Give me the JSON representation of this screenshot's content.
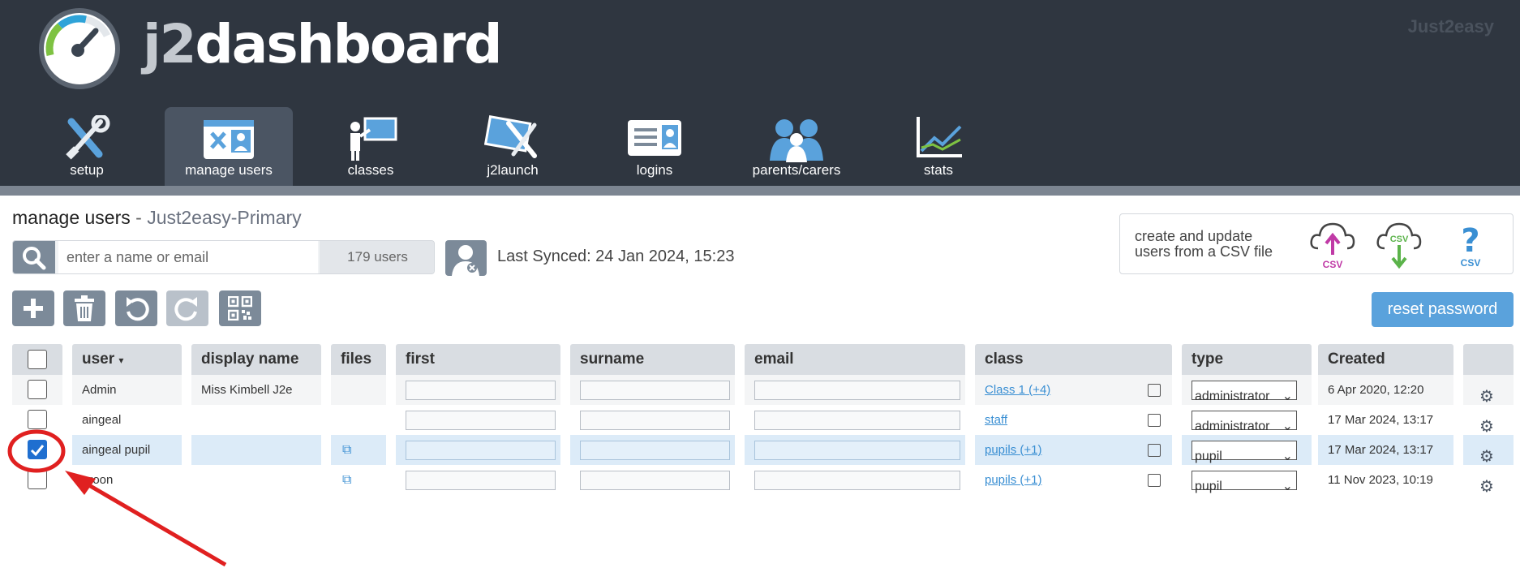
{
  "brand": {
    "logo": "j2dashboard",
    "logo_prefix": "j2",
    "logo_suffix": "dashboard",
    "right": "Just2easy"
  },
  "nav": [
    {
      "label": "setup",
      "icon": "tools-icon"
    },
    {
      "label": "manage users",
      "icon": "manage-users-icon",
      "active": true
    },
    {
      "label": "classes",
      "icon": "classroom-icon"
    },
    {
      "label": "j2launch",
      "icon": "launch-icon"
    },
    {
      "label": "logins",
      "icon": "id-card-icon"
    },
    {
      "label": "parents/carers",
      "icon": "people-icon"
    },
    {
      "label": "stats",
      "icon": "chart-icon"
    }
  ],
  "page": {
    "title": "manage users",
    "separator": "-",
    "school": "Just2easy-Primary"
  },
  "search": {
    "placeholder": "enter a name or email",
    "count": "179 users"
  },
  "sync": {
    "text": "Last Synced: 24 Jan 2024, 15:23"
  },
  "csv": {
    "text_line1": "create and update",
    "text_line2": "users from a CSV file",
    "upload_label": "CSV",
    "download_label": "CSV",
    "help_label": "CSV"
  },
  "toolbar": {
    "reset_label": "reset password"
  },
  "table": {
    "headers": [
      "user",
      "display name",
      "files",
      "first",
      "surname",
      "email",
      "class",
      "type",
      "Created"
    ],
    "sort_indicator": "▾",
    "rows": [
      {
        "user": "Admin",
        "display": "Miss Kimbell J2e",
        "files": false,
        "class": "Class 1 (+4)",
        "type": "administrator",
        "created": "6 Apr 2020, 12:20",
        "checked": false,
        "selected": false
      },
      {
        "user": "aingeal",
        "display": "",
        "files": false,
        "class": "staff",
        "type": "administrator",
        "created": "17 Mar 2024, 13:17",
        "checked": false,
        "selected": false
      },
      {
        "user": "aingeal pupil",
        "display": "",
        "files": true,
        "class": "pupils (+1)",
        "type": "pupil",
        "created": "17 Mar 2024, 13:17",
        "checked": true,
        "selected": true
      },
      {
        "user": "aroon",
        "display": "",
        "files": true,
        "class": "pupils (+1)",
        "type": "pupil",
        "created": "11 Nov 2023, 10:19",
        "checked": false,
        "selected": false
      }
    ],
    "type_options": [
      "administrator",
      "pupil"
    ]
  },
  "colors": {
    "header_bg": "#2f3640",
    "accent_blue": "#5aa2dc",
    "selected_row": "#dcebf8",
    "annotation_red": "#e02020"
  }
}
